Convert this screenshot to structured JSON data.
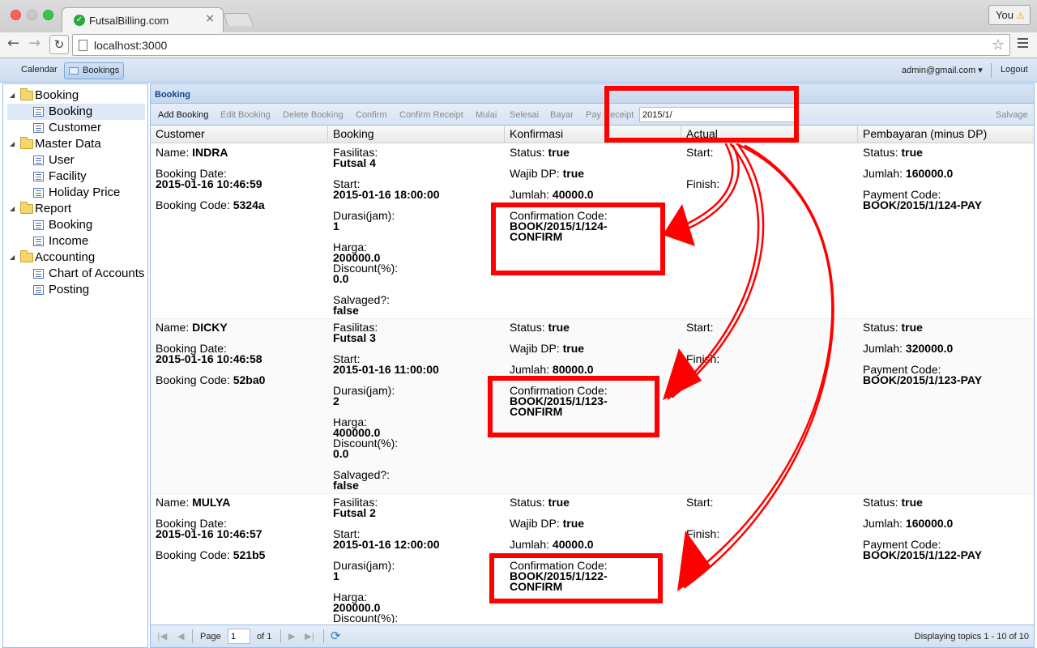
{
  "browser": {
    "tab_title": "FutsalBilling.com",
    "tab_close": "×",
    "url": "localhost:3000",
    "profile_label": "You",
    "profile_warn": "⚠"
  },
  "app_bar": {
    "tabs": [
      "Calendar",
      "Bookings"
    ],
    "user": "admin@gmail.com ▾",
    "logout": "Logout"
  },
  "sidebar": {
    "items": [
      {
        "label": "Booking",
        "kind": "folder"
      },
      {
        "label": "Booking",
        "kind": "leaf"
      },
      {
        "label": "Customer",
        "kind": "leaf"
      },
      {
        "label": "Master Data",
        "kind": "folder"
      },
      {
        "label": "User",
        "kind": "leaf"
      },
      {
        "label": "Facility",
        "kind": "leaf"
      },
      {
        "label": "Holiday Price",
        "kind": "leaf"
      },
      {
        "label": "Report",
        "kind": "folder"
      },
      {
        "label": "Booking",
        "kind": "leaf"
      },
      {
        "label": "Income",
        "kind": "leaf"
      },
      {
        "label": "Accounting",
        "kind": "folder"
      },
      {
        "label": "Chart of Accounts",
        "kind": "leaf"
      },
      {
        "label": "Posting",
        "kind": "leaf"
      }
    ]
  },
  "panel": {
    "title": "Booking",
    "toolbar": {
      "buttons": [
        "Add Booking",
        "Edit Booking",
        "Delete Booking",
        "Confirm",
        "Confirm Receipt",
        "Mulai",
        "Selesai",
        "Bayar",
        "Pay Receipt"
      ],
      "search_value": "2015/1/",
      "salvage": "Salvage"
    },
    "columns": [
      "Customer",
      "Booking",
      "Konfirmasi",
      "Actual",
      "Pembayaran (minus DP)"
    ],
    "labels": {
      "name": "Name: ",
      "booking_date": "Booking Date:",
      "booking_code": "Booking Code: ",
      "fasilitas": "Fasilitas:",
      "start": "Start:",
      "durasi": "Durasi(jam):",
      "harga": "Harga:",
      "discount": "Discount(%):",
      "salvaged": "Salvaged?:",
      "status": "Status: ",
      "wajib_dp": "Wajib DP: ",
      "jumlah": "Jumlah: ",
      "confirmation_code": "Confirmation Code:",
      "actual_start": "Start:",
      "actual_finish": "Finish:",
      "payment_code": "Payment Code:"
    },
    "rows": [
      {
        "name": "INDRA",
        "booking_date": "2015-01-16 10:46:59",
        "booking_code": "5324a",
        "fasilitas": "Futsal 4",
        "start": "2015-01-16 18:00:00",
        "durasi": "1",
        "harga": "200000.0",
        "discount": "0.0",
        "salvaged": "false",
        "k_status": "true",
        "k_wajib_dp": "true",
        "k_jumlah": "40000.0",
        "conf_code_1": "BOOK/2015/1/124-",
        "conf_code_2": "CONFIRM",
        "p_status": "true",
        "p_jumlah": "160000.0",
        "payment_code": "BOOK/2015/1/124-PAY"
      },
      {
        "name": "DICKY",
        "booking_date": "2015-01-16 10:46:58",
        "booking_code": "52ba0",
        "fasilitas": "Futsal 3",
        "start": "2015-01-16 11:00:00",
        "durasi": "2",
        "harga": "400000.0",
        "discount": "0.0",
        "salvaged": "false",
        "k_status": "true",
        "k_wajib_dp": "true",
        "k_jumlah": "80000.0",
        "conf_code_1": "BOOK/2015/1/123-",
        "conf_code_2": "CONFIRM",
        "p_status": "true",
        "p_jumlah": "320000.0",
        "payment_code": "BOOK/2015/1/123-PAY"
      },
      {
        "name": "MULYA",
        "booking_date": "2015-01-16 10:46:57",
        "booking_code": "521b5",
        "fasilitas": "Futsal 2",
        "start": "2015-01-16 12:00:00",
        "durasi": "1",
        "harga": "200000.0",
        "discount": "",
        "salvaged": "",
        "k_status": "true",
        "k_wajib_dp": "true",
        "k_jumlah": "40000.0",
        "conf_code_1": "BOOK/2015/1/122-",
        "conf_code_2": "CONFIRM",
        "p_status": "true",
        "p_jumlah": "160000.0",
        "payment_code": "BOOK/2015/1/122-PAY"
      }
    ],
    "pager": {
      "page_label": "Page",
      "page_value": "1",
      "of_label": "of 1",
      "display_text": "Displaying topics 1 - 10 of 10"
    }
  },
  "colors": {
    "annotation": "#ff0000",
    "panel_border": "#99bbe8",
    "header_text": "#15428b"
  }
}
